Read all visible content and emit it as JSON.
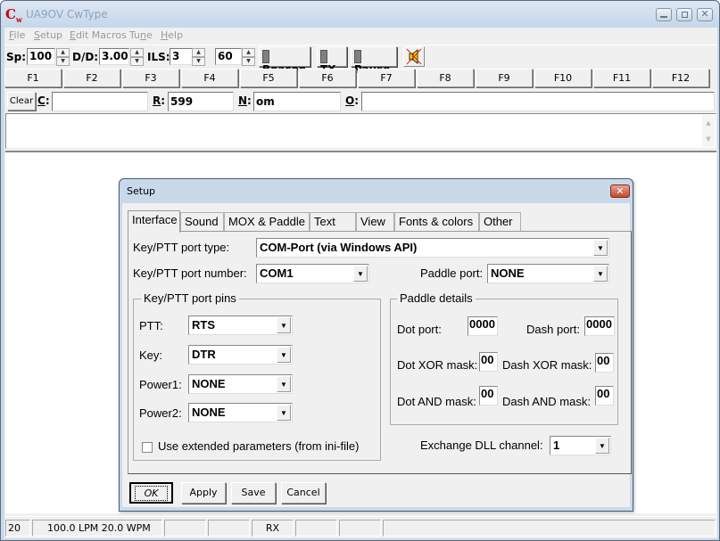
{
  "window": {
    "title": "UA9OV CwType",
    "logo": "Cw",
    "controls": [
      "minimize",
      "maximize",
      "close"
    ]
  },
  "menu": {
    "items": [
      {
        "label": "File",
        "mnemonic": "F"
      },
      {
        "label": "Setup",
        "mnemonic": "S"
      },
      {
        "label": "Edit Macros",
        "mnemonic": "E"
      },
      {
        "label": "Tune",
        "mnemonic": "n"
      },
      {
        "label": "Help",
        "mnemonic": "H"
      }
    ]
  },
  "toolbar": {
    "speed_label": "Sp:",
    "speed_value": "100",
    "dd_label": "D/D:",
    "dd_value": "3.00",
    "ils_label": "ILS:",
    "ils_value": "3",
    "extra_value": "60",
    "beacon_label": "Beacon",
    "tx_label": "TX",
    "pause_label": "Pause",
    "speaker_icon": "speaker-muted-icon"
  },
  "fkeys": [
    "F1",
    "F2",
    "F3",
    "F4",
    "F5",
    "F6",
    "F7",
    "F8",
    "F9",
    "F10",
    "F11",
    "F12"
  ],
  "qso": {
    "clear_label": "Clear",
    "call_label": "C",
    "call_value": "",
    "rst_label": "R",
    "rst_value": "599",
    "name_label": "N",
    "name_value": "om",
    "other_label": "O",
    "other_value": ""
  },
  "status": {
    "cells": [
      "20",
      "100.0 LPM  20.0 WPM",
      "",
      "",
      "RX",
      "",
      "",
      ""
    ]
  },
  "dialog": {
    "title": "Setup",
    "tabs": [
      "Interface",
      "Sound",
      "MOX & Paddle",
      "Text",
      "View",
      "Fonts & colors",
      "Other"
    ],
    "active_tab": "Interface",
    "port_type_label": "Key/PTT port type:",
    "port_type_value": "COM-Port (via Windows API)",
    "port_number_label": "Key/PTT port number:",
    "port_number_value": "COM1",
    "paddle_port_label": "Paddle port:",
    "paddle_port_value": "NONE",
    "pins_group": {
      "title": "Key/PTT port pins",
      "ptt_label": "PTT:",
      "ptt_value": "RTS",
      "key_label": "Key:",
      "key_value": "DTR",
      "power1_label": "Power1:",
      "power1_value": "NONE",
      "power2_label": "Power2:",
      "power2_value": "NONE",
      "extended_label": "Use extended parameters (from ini-file)",
      "extended_checked": false
    },
    "paddle_group": {
      "title": "Paddle details",
      "dot_port_label": "Dot port:",
      "dot_port_value": "0000",
      "dash_port_label": "Dash port:",
      "dash_port_value": "0000",
      "dot_xor_label": "Dot XOR mask:",
      "dot_xor_value": "00",
      "dash_xor_label": "Dash XOR mask:",
      "dash_xor_value": "00",
      "dot_and_label": "Dot AND mask:",
      "dot_and_value": "00",
      "dash_and_label": "Dash AND mask:",
      "dash_and_value": "00"
    },
    "exchange_label": "Exchange DLL channel:",
    "exchange_value": "1",
    "buttons": {
      "ok": "OK",
      "apply": "Apply",
      "save": "Save",
      "cancel": "Cancel"
    }
  }
}
